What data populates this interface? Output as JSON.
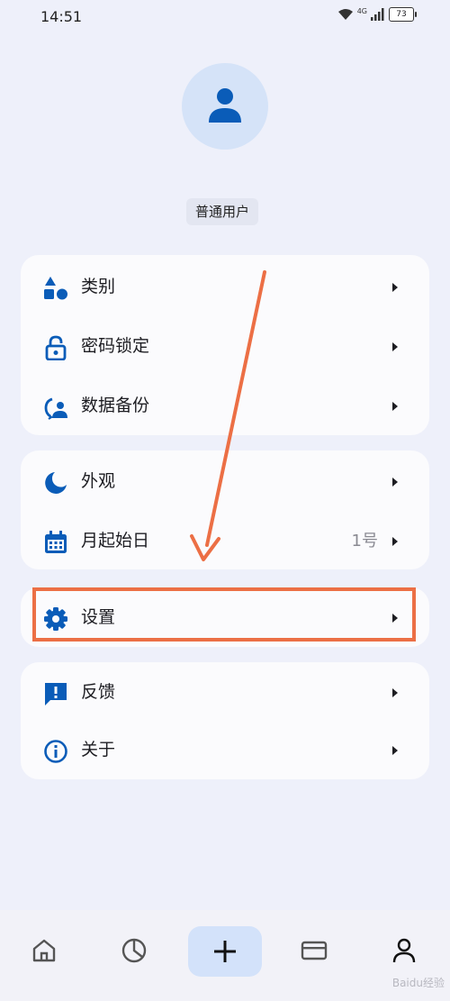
{
  "status_bar": {
    "time": "14:51",
    "network": "4G",
    "battery": "73"
  },
  "profile": {
    "username": "普通用户"
  },
  "menu": {
    "group1": [
      {
        "label": "类别",
        "icon": "category-icon"
      },
      {
        "label": "密码锁定",
        "icon": "lock-icon"
      },
      {
        "label": "数据备份",
        "icon": "backup-icon"
      }
    ],
    "group2": [
      {
        "label": "外观",
        "icon": "moon-icon"
      },
      {
        "label": "月起始日",
        "icon": "calendar-icon",
        "value": "1号"
      }
    ],
    "group3": [
      {
        "label": "设置",
        "icon": "gear-icon"
      }
    ],
    "group4": [
      {
        "label": "反馈",
        "icon": "feedback-icon"
      },
      {
        "label": "关于",
        "icon": "info-icon"
      }
    ]
  },
  "bottom_nav": [
    "home-icon",
    "chart-icon",
    "add-icon",
    "card-icon",
    "profile-icon"
  ],
  "watermark": "Baidu经验",
  "colors": {
    "accent": "#0a5cb8",
    "highlight": "#ec6f45",
    "background": "#eef0fa"
  }
}
